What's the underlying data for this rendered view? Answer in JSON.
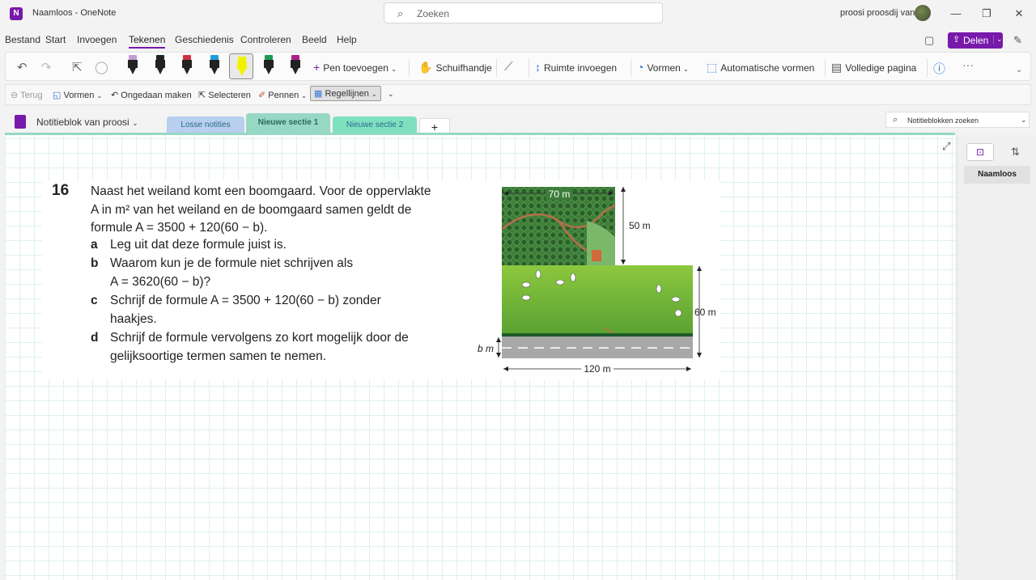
{
  "app": {
    "logo_letter": "N",
    "document_name": "Naamloos",
    "separator": "-",
    "app_name": "OneNote",
    "search_placeholder": "Zoeken",
    "user_name": "proosi proosdij van"
  },
  "window_controls": {
    "minimize": "—",
    "maximize": "❐",
    "close": "✕"
  },
  "menu": {
    "items": [
      "Bestand",
      "Start",
      "Invoegen",
      "Tekenen",
      "Geschiedenis",
      "Controleren",
      "Beeld",
      "Help"
    ],
    "active": "Tekenen",
    "share_label": "Delen"
  },
  "ribbon": {
    "add_pen": "Pen toevoegen",
    "hand": "Schuifhandje",
    "insert_space": "Ruimte invoegen",
    "shapes": "Vormen",
    "auto_shapes": "Automatische vormen",
    "full_page": "Volledige pagina",
    "more": "···"
  },
  "pens": [
    {
      "name": "eraser",
      "cap": "#c79bd6",
      "body": "#222"
    },
    {
      "name": "black-pen",
      "cap": "#222",
      "body": "#222"
    },
    {
      "name": "red-pen",
      "cap": "#d03040",
      "body": "#222"
    },
    {
      "name": "blue-pen",
      "cap": "#1aa0d8",
      "body": "#222"
    },
    {
      "name": "yellow-highlighter",
      "cap": "#f2f200",
      "body": "#f2f200"
    },
    {
      "name": "green-pen",
      "cap": "#1a9a50",
      "body": "#222"
    },
    {
      "name": "purple-pen",
      "cap": "#b0208a",
      "body": "#222"
    }
  ],
  "toolbar2": {
    "back": "Terug",
    "shapes": "Vormen",
    "undo": "Ongedaan maken",
    "select": "Selecteren",
    "pens": "Pennen",
    "rule_lines": "Regellijnen"
  },
  "notebook": {
    "name": "Notitieblok van proosi",
    "sections": [
      {
        "label": "Losse notities",
        "color": "#b8cfee",
        "active": false
      },
      {
        "label": "Nieuwe sectie 1",
        "color": "#96d8c4",
        "active": true
      },
      {
        "label": "Nieuwe sectie 2",
        "color": "#7fe0c0",
        "active": false
      }
    ],
    "add_section": "+",
    "search_label": "Notitieblokken zoeken"
  },
  "exercise": {
    "number": "16",
    "intro_lines": [
      "Naast het weiland komt een boomgaard. Voor de oppervlakte",
      "A in m² van het weiland en de boomgaard samen geldt de",
      "formule A = 3500 + 120(60 − b)."
    ],
    "questions": [
      {
        "letter": "a",
        "lines": [
          "Leg uit dat deze formule juist is."
        ]
      },
      {
        "letter": "b",
        "lines": [
          "Waarom kun je de formule niet schrijven als",
          "A = 3620(60 − b)?"
        ]
      },
      {
        "letter": "c",
        "lines": [
          "Schrijf de formule A = 3500 + 120(60 − b) zonder",
          "haakjes."
        ]
      },
      {
        "letter": "d",
        "lines": [
          "Schrijf de formule vervolgens zo kort mogelijk door de",
          "gelijksoortige termen samen te nemen."
        ]
      }
    ]
  },
  "figure": {
    "top_width": "70 m",
    "orchard_height": "50 m",
    "field_height": "60 m",
    "road_width": "b m",
    "total_width": "120 m"
  },
  "page_list": {
    "pages": [
      "Naamloos"
    ]
  }
}
